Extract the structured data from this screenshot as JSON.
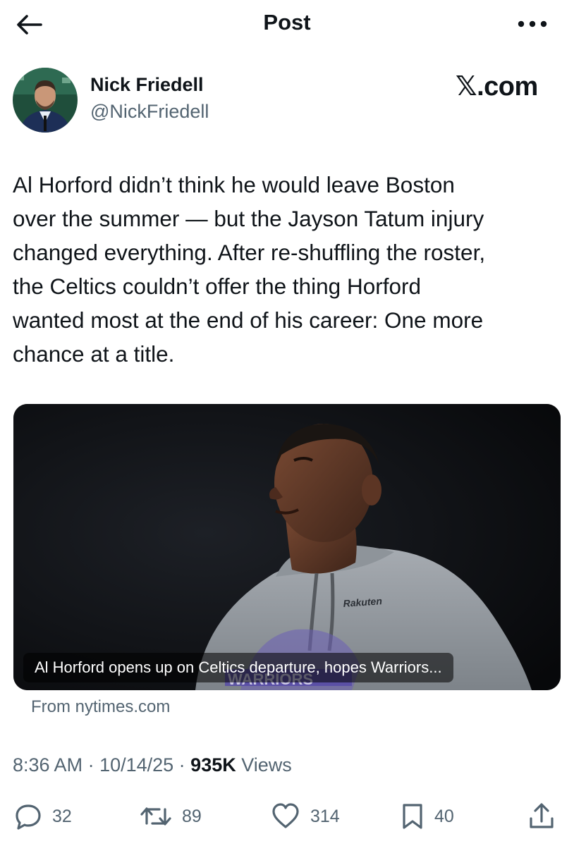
{
  "header": {
    "title": "Post",
    "back_icon": "arrow-left-icon",
    "more_icon": "more-horizontal-icon"
  },
  "author": {
    "name": "Nick Friedell",
    "handle": "@NickFriedell"
  },
  "source_mark": "𝕏.com",
  "tweet": {
    "lines": [
      "Al Horford didn’t think he would leave Boston",
      "over the summer — but the Jayson Tatum injury",
      "changed everything. After re-shuffling the roster,",
      "the Celtics couldn’t offer the thing Horford",
      "wanted most at the end of his career: One more",
      "chance at a title."
    ]
  },
  "card": {
    "headline": "Al Horford opens up on Celtics departure, hopes Warriors...",
    "source": "From nytimes.com",
    "jersey_brand": "Rakuten",
    "jersey_text": "WARRIORS"
  },
  "meta": {
    "time": "8:36 AM",
    "sep1": " · ",
    "date": "10/14/25",
    "sep2": " · ",
    "views_count": "935K",
    "views_label": " Views"
  },
  "actions": {
    "replies": "32",
    "reposts": "89",
    "likes": "314",
    "bookmarks": "40"
  },
  "colors": {
    "text": "#0f1419",
    "secondary": "#536471",
    "background": "#ffffff"
  }
}
